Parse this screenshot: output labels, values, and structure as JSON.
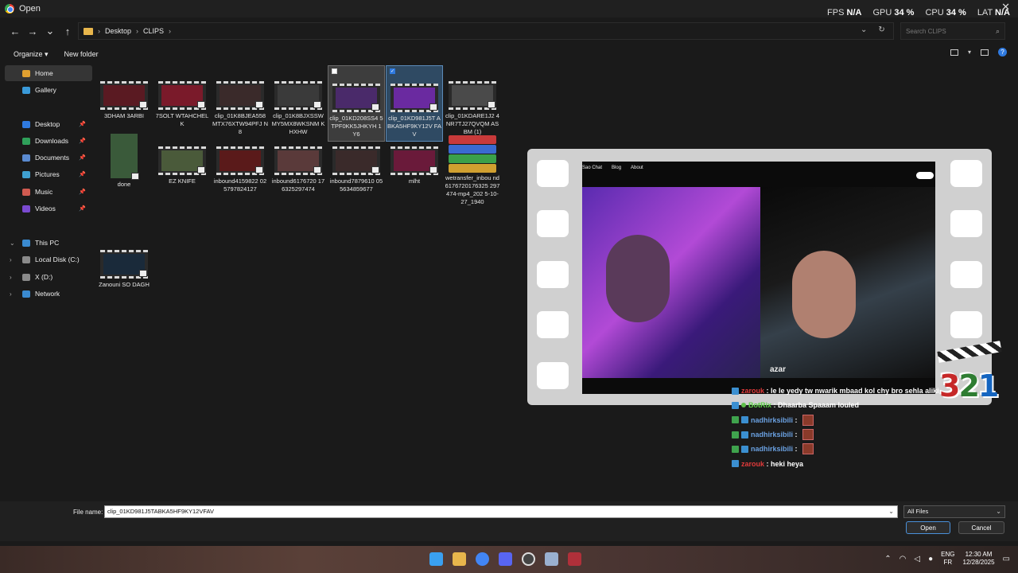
{
  "window": {
    "title": "Open",
    "close_glyph": "✕"
  },
  "overlay": [
    {
      "label": "FPS",
      "value": "N/A"
    },
    {
      "label": "GPU",
      "value": "34 %"
    },
    {
      "label": "CPU",
      "value": "34 %"
    },
    {
      "label": "LAT",
      "value": "N/A"
    }
  ],
  "nav": {
    "back": "←",
    "forward": "→",
    "recent": "⌄",
    "up": "↑",
    "breadcrumb": [
      "Desktop",
      "CLIPS"
    ],
    "search_placeholder": "Search CLIPS"
  },
  "toolbar": {
    "organize": "Organize ▾",
    "new_folder": "New folder",
    "help": "?"
  },
  "sidebar": [
    {
      "label": "Home",
      "icon": "home-icon",
      "color": "#e0a030",
      "active": true
    },
    {
      "label": "Gallery",
      "icon": "gallery-icon",
      "color": "#3a9ad9"
    },
    {
      "label": "Desktop",
      "icon": "desktop-icon",
      "color": "#2f7ae0",
      "pinned": true
    },
    {
      "label": "Downloads",
      "icon": "downloads-icon",
      "color": "#2fa05a",
      "pinned": true
    },
    {
      "label": "Documents",
      "icon": "documents-icon",
      "color": "#5a8ad0",
      "pinned": true
    },
    {
      "label": "Pictures",
      "icon": "pictures-icon",
      "color": "#3fa0d0",
      "pinned": true
    },
    {
      "label": "Music",
      "icon": "music-icon",
      "color": "#d05a50",
      "pinned": true
    },
    {
      "label": "Videos",
      "icon": "videos-icon",
      "color": "#7a4ad0",
      "pinned": true
    },
    {
      "label": "This PC",
      "icon": "pc-icon",
      "color": "#3a8ad0",
      "expand": "⌄"
    },
    {
      "label": "Local Disk (C:)",
      "icon": "disk-icon",
      "color": "#8a8a8a",
      "expand": "›"
    },
    {
      "label": "X (D:)",
      "icon": "disk-icon",
      "color": "#8a8a8a",
      "expand": "›"
    },
    {
      "label": "Network",
      "icon": "network-icon",
      "color": "#3a8ad0",
      "expand": "›"
    }
  ],
  "files": [
    {
      "name": "3DHAM 3ARBI",
      "thumb": "#5a1a22"
    },
    {
      "name": "7SOLT WTAHCHELK",
      "thumb": "#7a1a2a"
    },
    {
      "name": "clip_01K8BJEA558 MTX76XTW94PFJ N8",
      "thumb": "#3a2a2a"
    },
    {
      "name": "clip_01K8BJXSSW MY5MX8WKSNM KHXHW",
      "thumb": "#3a3a3a"
    },
    {
      "name": "clip_01KD208SS4 5TPF0KK5JHKYH 1Y6",
      "thumb": "#4a2a6a",
      "state": "hover"
    },
    {
      "name": "clip_01KD981J5T ABKA5HF9KY12V FAV",
      "thumb": "#6a2aa0",
      "state": "selected",
      "check": "✓"
    },
    {
      "name": "clip_01KDARE1J2 4NR7TJ27QVQM ASBM (1)",
      "thumb": "#4a4a4a"
    },
    {
      "name": "done",
      "thumb": "#3a5a3a",
      "kind": "portrait"
    },
    {
      "name": "EZ KNIFE",
      "thumb": "#4a5a3a"
    },
    {
      "name": "inbound4159822 025797824127",
      "thumb": "#5a1a1a"
    },
    {
      "name": "inbound6176720 176325297474",
      "thumb": "#5a3a3a"
    },
    {
      "name": "inbound7879610 055634859677",
      "thumb": "#3a2a2a"
    },
    {
      "name": "mlht",
      "thumb": "#6a1a3a"
    },
    {
      "name": "wetransfer_inbou nd6176720176325 297474-mp4_202 5-10-27_1940",
      "kind": "archive"
    },
    {
      "name": "Zanouni SO DAGH",
      "thumb": "#1a2a3a"
    }
  ],
  "preview": {
    "nav_links": [
      "Sao Chat",
      "Blog",
      "About"
    ],
    "caption": "azar",
    "logo_digits": [
      "3",
      "2",
      "1"
    ],
    "chat": [
      {
        "user": "zarouk",
        "color": "#e03a3a",
        "icons": [
          "blue"
        ],
        "message": "le le yedy tw nwarik mbaad kol chy bro sehla aliki"
      },
      {
        "user": "BotRix",
        "color": "#5fd04a",
        "icons": [
          "blue",
          "dot"
        ],
        "message": "Dhaarba Spaaam louled"
      },
      {
        "user": "nadhirksibili",
        "color": "#6aa0e0",
        "icons": [
          "green",
          "blue"
        ],
        "message": "",
        "emote": true
      },
      {
        "user": "nadhirksibili",
        "color": "#6aa0e0",
        "icons": [
          "green",
          "blue"
        ],
        "message": "",
        "emote": true
      },
      {
        "user": "nadhirksibili",
        "color": "#6aa0e0",
        "icons": [
          "green",
          "blue"
        ],
        "message": "",
        "emote": true
      },
      {
        "user": "zarouk",
        "color": "#e03a3a",
        "icons": [
          "blue"
        ],
        "message": "heki heya"
      }
    ]
  },
  "footer": {
    "file_name_label": "File name:",
    "file_name_value": "clip_01KD981J5TABKA5HF9KY12VFAV",
    "filter_value": "All Files",
    "open_label": "Open",
    "cancel_label": "Cancel"
  },
  "taskbar": {
    "apps": [
      "start-icon",
      "explorer-icon",
      "chrome-icon",
      "discord-icon",
      "obs-icon",
      "settings-icon",
      "app-icon"
    ],
    "app_colors": [
      "#3aa0f0",
      "#e8b64c",
      "#4285f4",
      "#5865f2",
      "#444444",
      "#9ab0d0",
      "#b0303a"
    ],
    "language": [
      "ENG",
      "FR"
    ],
    "time": "12:30 AM",
    "date": "12/28/2025"
  }
}
